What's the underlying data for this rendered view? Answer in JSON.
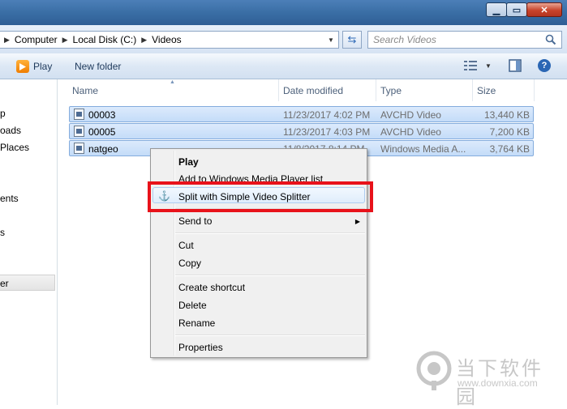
{
  "window": {
    "controls": [
      "minimize",
      "maximize",
      "close"
    ]
  },
  "address": {
    "crumbs": [
      "Computer",
      "Local Disk (C:)",
      "Videos"
    ],
    "search_placeholder": "Search Videos"
  },
  "toolbar": {
    "play_label": "Play",
    "new_folder_label": "New folder"
  },
  "nav": {
    "items": [
      "p",
      "oads",
      "Places",
      "ents",
      "s",
      "er"
    ]
  },
  "columns": {
    "name": "Name",
    "date": "Date modified",
    "type": "Type",
    "size": "Size"
  },
  "files": [
    {
      "name": "00003",
      "date": "11/23/2017 4:02 PM",
      "type": "AVCHD Video",
      "size": "13,440 KB"
    },
    {
      "name": "00005",
      "date": "11/23/2017 4:03 PM",
      "type": "AVCHD Video",
      "size": "7,200 KB"
    },
    {
      "name": "natgeo",
      "date": "11/8/2017 8:14 PM",
      "type": "Windows Media A...",
      "size": "3,764 KB"
    }
  ],
  "context_menu": {
    "play": "Play",
    "add_to_playlist": "Add to Windows Media Player list",
    "split": "Split with Simple Video Splitter",
    "send_to": "Send to",
    "cut": "Cut",
    "copy": "Copy",
    "create_shortcut": "Create shortcut",
    "delete": "Delete",
    "rename": "Rename",
    "properties": "Properties"
  },
  "watermark": {
    "title": "当下软件园",
    "url": "www.downxia.com"
  },
  "colors": {
    "highlight_box": "#e8121a",
    "selection": "#c4dcf8"
  }
}
